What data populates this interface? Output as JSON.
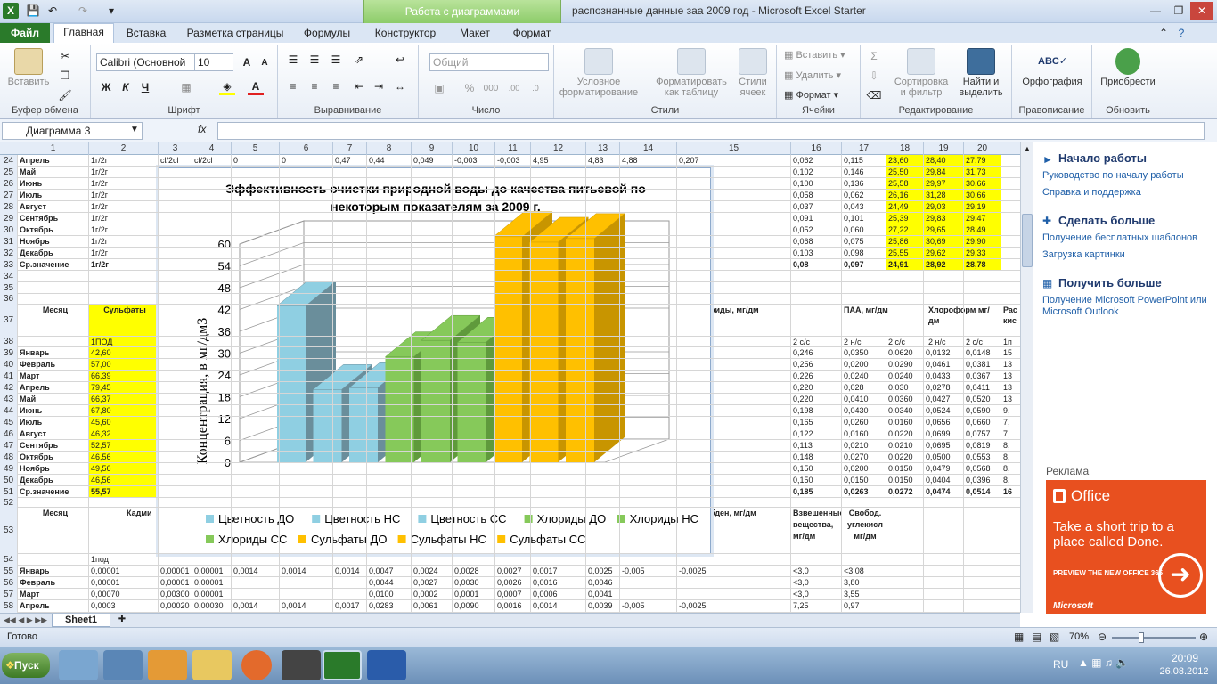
{
  "window": {
    "title": "распознанные данные заа 2009 год  -  Microsoft Excel Starter",
    "context_tab": "Работа с диаграммами"
  },
  "tabs": [
    "Файл",
    "Главная",
    "Вставка",
    "Разметка страницы",
    "Формулы",
    "Конструктор",
    "Макет",
    "Формат"
  ],
  "ribbon": {
    "paste": "Вставить",
    "clipboard": "Буфер обмена",
    "font_name": "Calibri (Основной",
    "font_size": "10",
    "font": "Шрифт",
    "alignment": "Выравнивание",
    "number_format": "Общий",
    "number": "Число",
    "cond_format_1": "Условное",
    "cond_format_2": "форматирование",
    "format_table_1": "Форматировать",
    "format_table_2": "как таблицу",
    "cell_styles_1": "Стили",
    "cell_styles_2": "ячеек",
    "styles": "Стили",
    "insert": "Вставить",
    "delete": "Удалить",
    "format": "Формат",
    "cells": "Ячейки",
    "sort_1": "Сортировка",
    "sort_2": "и фильтр",
    "find_1": "Найти и",
    "find_2": "выделить",
    "editing": "Редактирование",
    "spelling": "Орфография",
    "proofing": "Правописание",
    "updates": "Приобрести",
    "update": "Обновить"
  },
  "formula_bar": {
    "name_box": "Диаграмма 3",
    "fx": "fx"
  },
  "columns": [
    "1",
    "2",
    "3",
    "4",
    "5",
    "6",
    "7",
    "8",
    "9",
    "10",
    "11",
    "12",
    "13",
    "14",
    "15",
    "16",
    "17",
    "18",
    "19",
    "20"
  ],
  "rows": [
    {
      "n": "24",
      "c": [
        "Апрель",
        "1г/2г",
        "cl/2cl",
        "cl/2cl",
        "0",
        "0",
        "0,47",
        "0,44",
        "0,049",
        "-0,003",
        "-0,003",
        "4,95",
        "4,83",
        "4,88",
        "0,207",
        "0,062",
        "0,115",
        "23,60",
        "28,40",
        "27,79"
      ]
    },
    {
      "n": "25",
      "c": [
        "Май",
        "1г/2г",
        "",
        "",
        "",
        "",
        "",
        "",
        "",
        "",
        "",
        "",
        "",
        "",
        "",
        "0,102",
        "0,146",
        "25,50",
        "29,84",
        "31,73"
      ]
    },
    {
      "n": "26",
      "c": [
        "Июнь",
        "1г/2г",
        "",
        "",
        "",
        "",
        "",
        "",
        "",
        "",
        "",
        "",
        "",
        "",
        "",
        "0,100",
        "0,136",
        "25,58",
        "29,97",
        "30,66"
      ]
    },
    {
      "n": "27",
      "c": [
        "Июль",
        "1г/2г",
        "",
        "",
        "",
        "",
        "",
        "",
        "",
        "",
        "",
        "",
        "",
        "",
        "",
        "0,058",
        "0,062",
        "26,16",
        "31,28",
        "30,66"
      ]
    },
    {
      "n": "28",
      "c": [
        "Август",
        "1г/2г",
        "",
        "",
        "",
        "",
        "",
        "",
        "",
        "",
        "",
        "",
        "",
        "",
        "",
        "0,037",
        "0,043",
        "24,49",
        "29,03",
        "29,19"
      ]
    },
    {
      "n": "29",
      "c": [
        "Сентябрь",
        "1г/2г",
        "",
        "",
        "",
        "",
        "",
        "",
        "",
        "",
        "",
        "",
        "",
        "",
        "",
        "0,091",
        "0,101",
        "25,39",
        "29,83",
        "29,47"
      ]
    },
    {
      "n": "30",
      "c": [
        "Октябрь",
        "1г/2г",
        "",
        "",
        "",
        "",
        "",
        "",
        "",
        "",
        "",
        "",
        "",
        "",
        "",
        "0,052",
        "0,060",
        "27,22",
        "29,65",
        "28,49"
      ]
    },
    {
      "n": "31",
      "c": [
        "Ноябрь",
        "1г/2г",
        "",
        "",
        "",
        "",
        "",
        "",
        "",
        "",
        "",
        "",
        "",
        "",
        "",
        "0,068",
        "0,075",
        "25,86",
        "30,69",
        "29,90"
      ]
    },
    {
      "n": "32",
      "c": [
        "Декабрь",
        "1г/2г",
        "",
        "",
        "",
        "",
        "",
        "",
        "",
        "",
        "",
        "",
        "",
        "",
        "",
        "0,103",
        "0,098",
        "25,55",
        "29,62",
        "29,33"
      ]
    },
    {
      "n": "33",
      "c": [
        "Ср.значение",
        "1г/2г",
        "",
        "",
        "",
        "",
        "",
        "",
        "",
        "",
        "",
        "",
        "",
        "",
        "",
        "0,08",
        "0,097",
        "24,91",
        "28,92",
        "28,78"
      ]
    }
  ],
  "rows_b": [
    {
      "n": "39",
      "c": [
        "Январь",
        "42,60",
        "0,246",
        "0,0350",
        "0,0620",
        "0,0132",
        "0,0148",
        "15"
      ]
    },
    {
      "n": "40",
      "c": [
        "Февраль",
        "57,00",
        "0,256",
        "0,0200",
        "0,0290",
        "0,0461",
        "0,0381",
        "13"
      ]
    },
    {
      "n": "41",
      "c": [
        "Март",
        "66,39",
        "0,226",
        "0,0240",
        "0,0240",
        "0,0433",
        "0,0367",
        "13"
      ]
    },
    {
      "n": "42",
      "c": [
        "Апрель",
        "79,45",
        "0,220",
        "0,028",
        "0,030",
        "0,0278",
        "0,0411",
        "13"
      ]
    },
    {
      "n": "43",
      "c": [
        "Май",
        "66,37",
        "0,220",
        "0,0410",
        "0,0360",
        "0,0427",
        "0,0520",
        "13"
      ]
    },
    {
      "n": "44",
      "c": [
        "Июнь",
        "67,80",
        "0,198",
        "0,0430",
        "0,0340",
        "0,0524",
        "0,0590",
        "9,"
      ]
    },
    {
      "n": "45",
      "c": [
        "Июль",
        "45,60",
        "0,165",
        "0,0260",
        "0,0160",
        "0,0656",
        "0,0660",
        "7,"
      ]
    },
    {
      "n": "46",
      "c": [
        "Август",
        "46,32",
        "0,122",
        "0,0160",
        "0,0220",
        "0,0699",
        "0,0757",
        "7,"
      ]
    },
    {
      "n": "47",
      "c": [
        "Сентябрь",
        "52,57",
        "0,113",
        "0,0210",
        "0,0210",
        "0,0695",
        "0,0819",
        "8,"
      ]
    },
    {
      "n": "48",
      "c": [
        "Октябрь",
        "46,56",
        "0,148",
        "0,0270",
        "0,0220",
        "0,0500",
        "0,0553",
        "8,"
      ]
    },
    {
      "n": "49",
      "c": [
        "Ноябрь",
        "49,56",
        "0,150",
        "0,0200",
        "0,0150",
        "0,0479",
        "0,0568",
        "8,"
      ]
    },
    {
      "n": "50",
      "c": [
        "Декабрь",
        "46,56",
        "0,150",
        "0,0150",
        "0,0150",
        "0,0404",
        "0,0396",
        "8,"
      ]
    },
    {
      "n": "51",
      "c": [
        "Ср.значение",
        "55,57",
        "0,185",
        "0,0263",
        "0,0272",
        "0,0474",
        "0,0514",
        "16"
      ]
    }
  ],
  "headers_b": {
    "mesyac": "Месяц",
    "sulf": "Сульфаты",
    "pod": "1ПОД",
    "ridy": "риды, мг/дм",
    "paa": "ПАА, мг/дм",
    "hlor": "Хлороформ мг/дм",
    "ras": "Рас кис",
    "c2s": "2 с/с",
    "c2n": "2 н/с",
    "c2s2": "2 с/с",
    "c2n2": "2 н/с",
    "c2s3": "2 с/с",
    "c1n": "1п"
  },
  "rows_c": [
    {
      "n": "55",
      "c": [
        "Январь",
        "0,00001",
        "0,00001",
        "0,00001",
        "0,0014",
        "0,0014",
        "0,0014",
        "0,0047",
        "0,0024",
        "0,0028",
        "0,0027",
        "0,0017",
        "0,0025",
        "-0,005",
        "-0,0025",
        "<3,0",
        "<3,08"
      ]
    },
    {
      "n": "56",
      "c": [
        "Февраль",
        "0,00001",
        "0,00001",
        "0,00001",
        "",
        "",
        "",
        "0,0044",
        "0,0027",
        "0,0030",
        "0,0026",
        "0,0016",
        "0,0046",
        "",
        "",
        "<3,0",
        "3,80"
      ]
    },
    {
      "n": "57",
      "c": [
        "Март",
        "0,00070",
        "0,00300",
        "0,00001",
        "",
        "",
        "",
        "0,0100",
        "0,0002",
        "0,0001",
        "0,0007",
        "0,0006",
        "0,0041",
        "",
        "",
        "<3,0",
        "3,55"
      ]
    },
    {
      "n": "58",
      "c": [
        "Апрель",
        "0,0003",
        "0,00020",
        "0,00030",
        "0,0014",
        "0,0014",
        "0,0017",
        "0,0283",
        "0,0061",
        "0,0090",
        "0,0016",
        "0,0014",
        "0,0039",
        "-0,005",
        "-0,0025",
        "7,25",
        "0,97"
      ]
    }
  ],
  "headers_c": {
    "mesyac": "Месяц",
    "kadm": "Кадми",
    "vzv": "Взвешенные вещества, мг/дм",
    "svob": "Свобод. углекисл мг/дм",
    "bden": "бден, мг/дм",
    "pod": "1под"
  },
  "chart_data": {
    "type": "bar",
    "title": "Эффективность очистки природной воды до качества питьевой по некоторым показателям за 2009 г.",
    "ylabel": "Концентрация, в мг/дм3",
    "ylim": [
      0,
      60
    ],
    "yticks": [
      "0",
      "6",
      "12",
      "18",
      "24",
      "30",
      "36",
      "42",
      "48",
      "54",
      "60"
    ],
    "series": [
      {
        "name": "Цветность ДО",
        "value": 43,
        "color": "#8fcfe2",
        "dark": "#6a8e9b"
      },
      {
        "name": "Цветность НС",
        "value": 20,
        "color": "#8fcfe2",
        "dark": "#6a8e9b"
      },
      {
        "name": "Цветность СС",
        "value": 20.5,
        "color": "#8fcfe2",
        "dark": "#6a8e9b"
      },
      {
        "name": "Хлориды ДО",
        "value": 29,
        "color": "#86c95a",
        "dark": "#5f9a3c"
      },
      {
        "name": "Хлориды НС",
        "value": 33.5,
        "color": "#86c95a",
        "dark": "#5f9a3c"
      },
      {
        "name": "Хлориды СС",
        "value": 33,
        "color": "#86c95a",
        "dark": "#5f9a3c"
      },
      {
        "name": "Сульфаты ДО",
        "value": 62,
        "color": "#ffc000",
        "dark": "#c89500"
      },
      {
        "name": "Сульфаты НС",
        "value": 60.5,
        "color": "#ffc000",
        "dark": "#c89500"
      },
      {
        "name": "Сульфаты СС",
        "value": 61.5,
        "color": "#ffc000",
        "dark": "#c89500"
      }
    ]
  },
  "pane": {
    "start": "Начало работы",
    "guide": "Руководство по началу работы",
    "help": "Справка и поддержка",
    "more": "Сделать больше",
    "templates": "Получение бесплатных шаблонов",
    "clipart": "Загрузка картинки",
    "get_more": "Получить больше",
    "ppt_1": "Получение Microsoft PowerPoint или",
    "ppt_2": "Microsoft Outlook",
    "ad_label": "Реклама",
    "ad_brand": "Office",
    "ad_1": "Take a short trip to a",
    "ad_2": "place called Done.",
    "ad_cta": "PREVIEW THE NEW OFFICE 365",
    "ad_ms": "Microsoft"
  },
  "sheet_tab": "Sheet1",
  "status": {
    "ready": "Готово",
    "zoom": "70%"
  },
  "taskbar": {
    "start": "Пуск",
    "lang": "RU",
    "time": "20:09",
    "date": "26.08.2012"
  }
}
